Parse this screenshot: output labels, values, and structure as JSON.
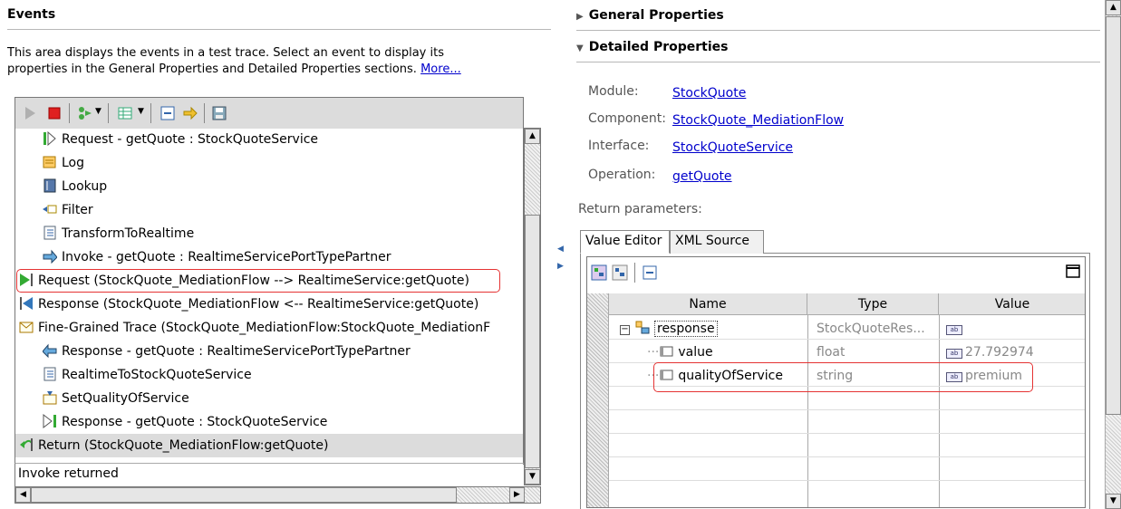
{
  "events": {
    "title": "Events",
    "description_line1": "This area displays the events in a test trace. Select an event to display its",
    "description_line2": "properties in the General Properties and Detailed Properties sections.",
    "more_link": "More...",
    "tree_items": [
      {
        "icon": "request-in-icon",
        "label": "Request - getQuote : StockQuoteService"
      },
      {
        "icon": "log-icon",
        "label": "Log"
      },
      {
        "icon": "lookup-icon",
        "label": "Lookup"
      },
      {
        "icon": "filter-icon",
        "label": "Filter"
      },
      {
        "icon": "transform-icon",
        "label": "TransformToRealtime"
      },
      {
        "icon": "invoke-icon",
        "label": "Invoke - getQuote : RealtimeServicePortTypePartner"
      },
      {
        "icon": "request-out-icon",
        "label": "Request (StockQuote_MediationFlow --> RealtimeService:getQuote)"
      },
      {
        "icon": "response-icon",
        "label": "Response (StockQuote_MediationFlow <-- RealtimeService:getQuote)"
      },
      {
        "icon": "fine-trace-icon",
        "label": "Fine-Grained Trace (StockQuote_MediationFlow:StockQuote_MediationF"
      },
      {
        "icon": "response-partner-icon",
        "label": "Response - getQuote : RealtimeServicePortTypePartner"
      },
      {
        "icon": "transform-icon",
        "label": "RealtimeToStockQuoteService"
      },
      {
        "icon": "set-qos-icon",
        "label": "SetQualityOfService"
      },
      {
        "icon": "response-out-icon",
        "label": "Response - getQuote : StockQuoteService"
      },
      {
        "icon": "return-icon",
        "label": "Return (StockQuote_MediationFlow:getQuote)"
      }
    ],
    "status_text": "Invoke returned"
  },
  "general_properties": {
    "title": "General Properties"
  },
  "detailed_properties": {
    "title": "Detailed Properties",
    "module_label": "Module:",
    "module_value": "StockQuote",
    "component_label": "Component:",
    "component_value": "StockQuote_MediationFlow",
    "interface_label": "Interface:",
    "interface_value": "StockQuoteService",
    "operation_label": "Operation:",
    "operation_value": "getQuote",
    "return_params_label": "Return parameters:",
    "tabs": [
      "Value Editor",
      "XML Source"
    ],
    "grid": {
      "columns": [
        "Name",
        "Type",
        "Value"
      ],
      "rows": [
        {
          "name": "response",
          "type": "StockQuoteRes...",
          "value": ""
        },
        {
          "name": "value",
          "type": "float",
          "value": "27.792974"
        },
        {
          "name": "qualityOfService",
          "type": "string",
          "value": "premium"
        }
      ]
    }
  },
  "colors": {
    "highlight_border": "#e53333",
    "link": "#0000cc"
  }
}
